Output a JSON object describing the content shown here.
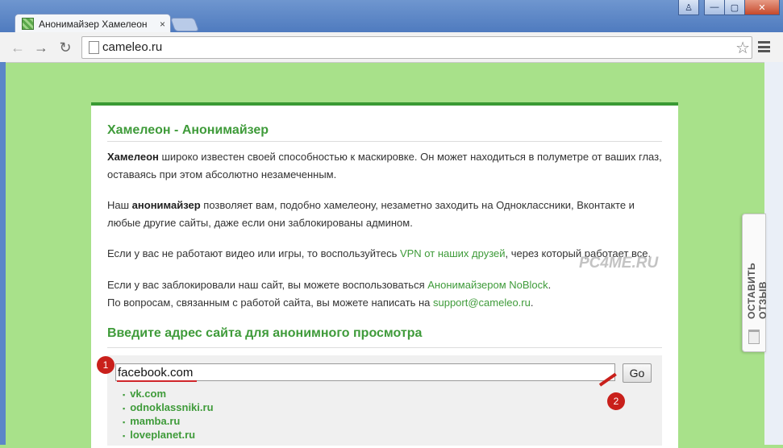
{
  "browser": {
    "tab_title": "Анонимайзер Хамелеон",
    "tab_close": "×",
    "url": "cameleo.ru",
    "win_user": "♙",
    "win_minimize": "—",
    "win_maximize": "▢",
    "win_close": "✕",
    "back": "←",
    "forward": "→",
    "reload": "↻",
    "star": "☆"
  },
  "page": {
    "title": "Хамелеон - Анонимайзер",
    "para1_bold": "Хамелеон",
    "para1_text": " широко известен своей способностью к маскировке. Он может находиться в полуметре от ваших глаз,",
    "para1_line2": "оставаясь при этом абсолютно незамеченным.",
    "para2_prefix": "Наш ",
    "para2_bold": "анонимайзер",
    "para2_text": " позволяет вам, подобно хамелеону, незаметно заходить на Одноклассники, Вконтакте и",
    "para2_line2": "любые другие сайты, даже если они заблокированы админом.",
    "para3_prefix": "Если у вас не работают видео или игры, то воспользуйтесь ",
    "para3_link": "VPN от наших друзей",
    "para3_suffix": ", через который работает все.",
    "para4_prefix": "Если у вас заблокировали наш сайт, вы можете воспользоваться ",
    "para4_link": "Анонимайзером NoBlock",
    "para4_suffix": ".",
    "para5_prefix": "По вопросам, связанным с работой сайта, вы можете написать на ",
    "para5_link": "support@cameleo.ru",
    "para5_suffix": ".",
    "section_title": "Введите адрес сайта для анонимного просмотра",
    "url_value": "facebook.com",
    "go_label": "Go",
    "sites": [
      "vk.com",
      "odnoklassniki.ru",
      "mamba.ru",
      "loveplanet.ru"
    ]
  },
  "annotations": {
    "badge1": "1",
    "badge2": "2",
    "watermark": "PC4ME.RU"
  },
  "feedback_tab": {
    "label": "ОСТАВИТЬ ОТЗЫВ"
  },
  "colors": {
    "accent_green": "#3f9b3a",
    "page_bg": "#a8e18a",
    "annotation_red": "#c9201b"
  }
}
